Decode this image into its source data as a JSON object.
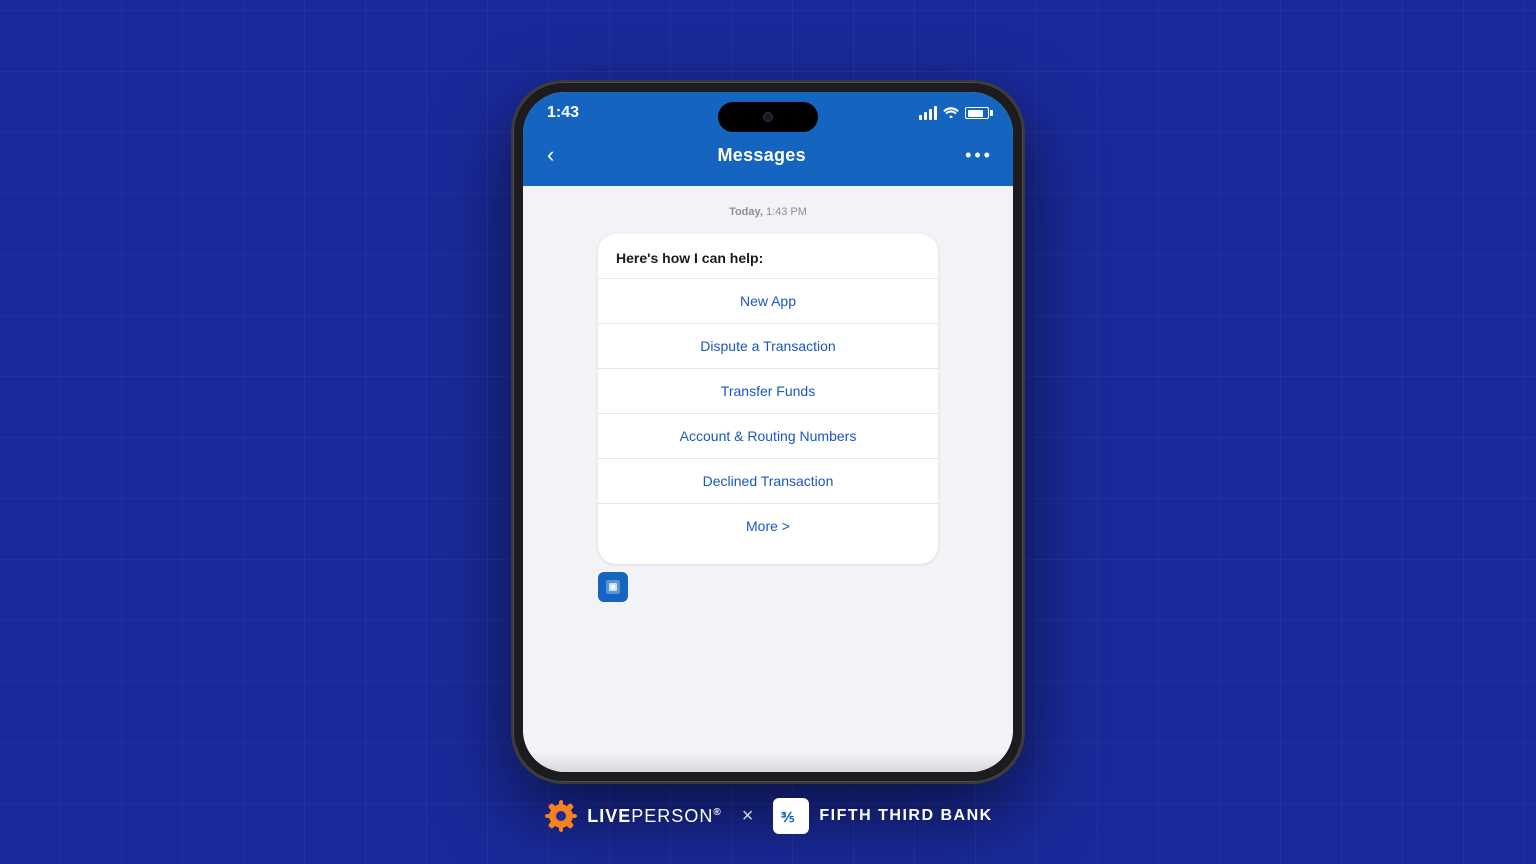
{
  "background": {
    "color": "#1a2a9b"
  },
  "status_bar": {
    "time": "1:43",
    "signal": "signal",
    "wifi": "wifi",
    "battery": "battery"
  },
  "nav": {
    "back_label": "<",
    "title": "Messages",
    "more_label": "•••"
  },
  "chat": {
    "timestamp": "Today, 1:43 PM",
    "bubble_header": "Here's how I can help:",
    "menu_items": [
      {
        "label": "New App",
        "id": "new-app"
      },
      {
        "label": "Dispute a Transaction",
        "id": "dispute-transaction"
      },
      {
        "label": "Transfer Funds",
        "id": "transfer-funds"
      },
      {
        "label": "Account & Routing Numbers",
        "id": "account-routing"
      },
      {
        "label": "Declined Transaction",
        "id": "declined-transaction"
      },
      {
        "label": "More >",
        "id": "more"
      }
    ]
  },
  "footer": {
    "liveperson_text": "LIVEPERSON",
    "liveperson_registered": "®",
    "x_divider": "×",
    "bank_name": "Fifth Third Bank"
  }
}
